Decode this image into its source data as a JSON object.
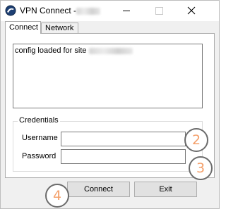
{
  "window": {
    "title": "VPN Connect -",
    "controls": {
      "minimize": "minimize",
      "maximize": "maximize",
      "close": "close"
    }
  },
  "tabs": [
    {
      "label": "Connect",
      "active": true
    },
    {
      "label": "Network",
      "active": false
    }
  ],
  "log": {
    "lines": [
      "config loaded for site"
    ]
  },
  "credentials": {
    "legend": "Credentials",
    "username_label": "Username",
    "username_value": "",
    "password_label": "Password",
    "password_value": ""
  },
  "buttons": {
    "connect": "Connect",
    "exit": "Exit"
  },
  "annotations": [
    "2",
    "3",
    "4"
  ],
  "colors": {
    "annotation_digit": "#f4a06b",
    "annotation_ring": "#6b6b6b",
    "window_bg": "#f0f0f0",
    "panel_bg": "#ffffff"
  },
  "icons": {
    "app": "vpn-app-icon",
    "minimize": "minimize-icon",
    "maximize": "maximize-icon",
    "close": "close-icon"
  }
}
